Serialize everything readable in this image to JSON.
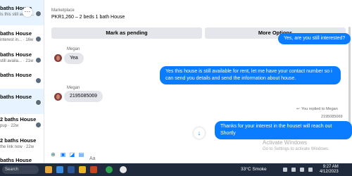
{
  "sidebar": {
    "conversations": [
      {
        "title": "baths House",
        "subtitle": "Is this still availa..."
      },
      {
        "title": "baths House",
        "subtitle": "interest in... · 16w"
      },
      {
        "title": "baths House",
        "subtitle": "still availa... · 21w"
      },
      {
        "title": "baths House",
        "subtitle": ""
      },
      {
        "title": "baths House",
        "subtitle": ""
      },
      {
        "title": "2 baths House",
        "subtitle": "pup · 22w"
      },
      {
        "title": "2 baths House",
        "subtitle": "the link now · 22w"
      },
      {
        "title": "baths House",
        "subtitle": ""
      }
    ]
  },
  "chat": {
    "marketplace_label": "Marketplace",
    "listing_title": "PKR1,260 – 2 beds 1 bath House",
    "mark_pending_label": "Mark as pending",
    "more_options_label": "More Options",
    "messages": {
      "m0": "Yes, are you still interested?",
      "sender1": "Megan",
      "m1": "Yea",
      "m2": "Yes this house is still available for rent, let me have your contact number so i can send you details and send the information about house.",
      "sender2": "Megan",
      "m3": "2195085069",
      "replied": "You replied to Megan",
      "quoted": "2195085069",
      "m4": "Thanks for your interest in the houseI will reach out Shortly"
    },
    "composer_placeholder": "Aa"
  },
  "watermark": {
    "line1": "Activate Windows",
    "line2": "Go to Settings to activate Windows."
  },
  "taskbar": {
    "search_label": "Search",
    "weather": "33°C  Smoke",
    "time": "9:27 AM",
    "date": "4/12/2023"
  },
  "colors": {
    "accent": "#0a7cff",
    "incoming": "#e4e6eb",
    "taskbar": "#1f2a3c"
  }
}
